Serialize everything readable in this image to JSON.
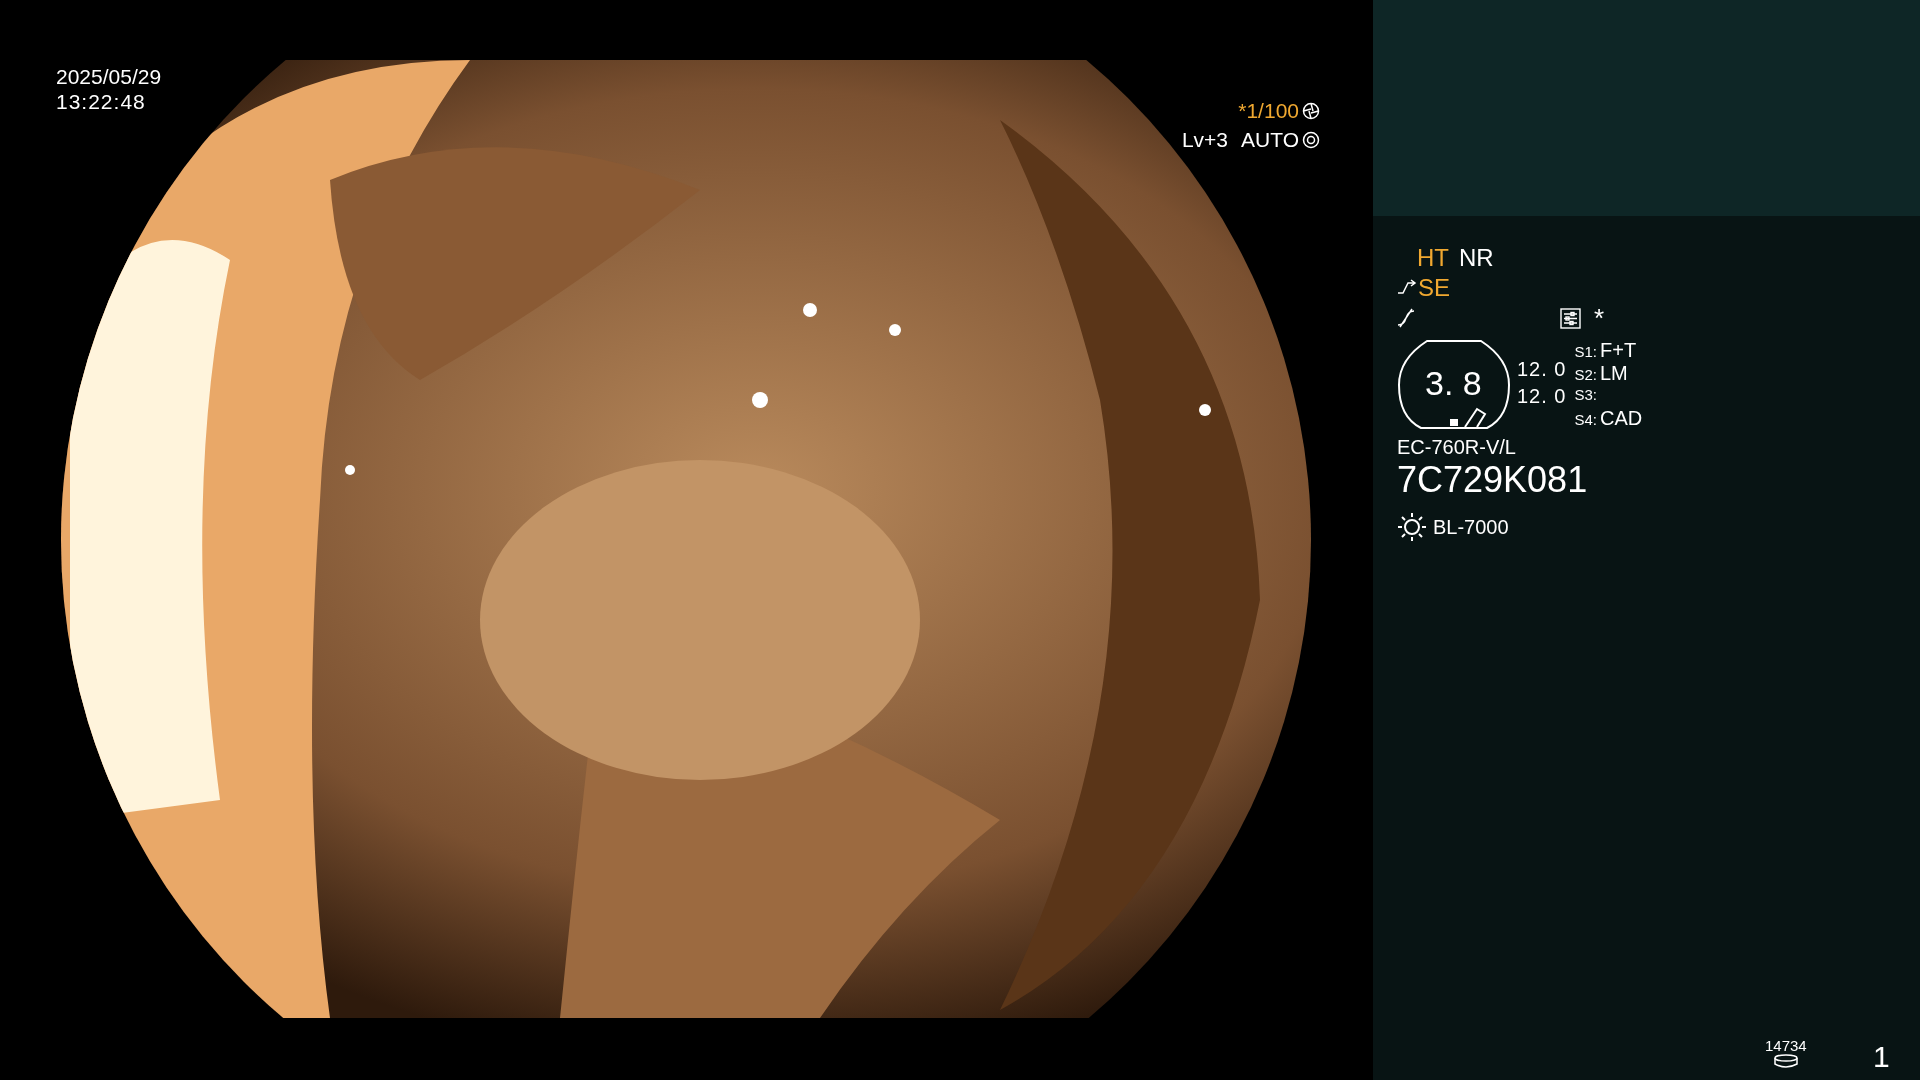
{
  "timestamp": {
    "date": "2025/05/29",
    "time": "13:22:48"
  },
  "shutter": {
    "value": "*1/100"
  },
  "exposure": {
    "level_text": "Lv+3",
    "mode": "AUTO"
  },
  "modes": [
    {
      "label": "HT",
      "on": true
    },
    {
      "label": "NR",
      "on": false
    }
  ],
  "enhancement": {
    "label": "SE",
    "on": true
  },
  "flag": "*",
  "zoom": {
    "value": "3. 8",
    "readings": [
      "12. 0",
      "12. 0"
    ]
  },
  "switches": [
    {
      "key": "S1:",
      "value": "F+T"
    },
    {
      "key": "S2:",
      "value": "LM"
    },
    {
      "key": "S3:"
    },
    {
      "key": "S4:",
      "value": "CAD"
    }
  ],
  "scope": {
    "model": "EC-760R-V/L",
    "serial": "7C729K081"
  },
  "light_source": "BL-7000",
  "counter": "14734",
  "page": "1"
}
